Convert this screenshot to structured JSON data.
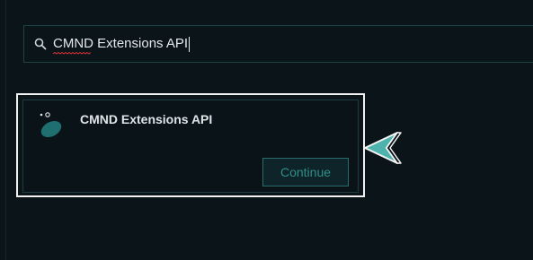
{
  "search": {
    "value": "CMND Extensions API",
    "misspelled_word": "CMND",
    "icon": "search-icon"
  },
  "result_card": {
    "title": "CMND Extensions API",
    "logo": "cmnd-logo-icon",
    "continue_label": "Continue"
  },
  "annotation": {
    "pointer": "chevron-left-arrow-icon"
  },
  "colors": {
    "background": "#0b1419",
    "border_teal": "#1f4246",
    "accent_teal": "#2f8f8c",
    "logo_teal": "#1f6e70",
    "highlight_white": "#f2f2f2",
    "pointer_teal": "#4fb3ad"
  }
}
